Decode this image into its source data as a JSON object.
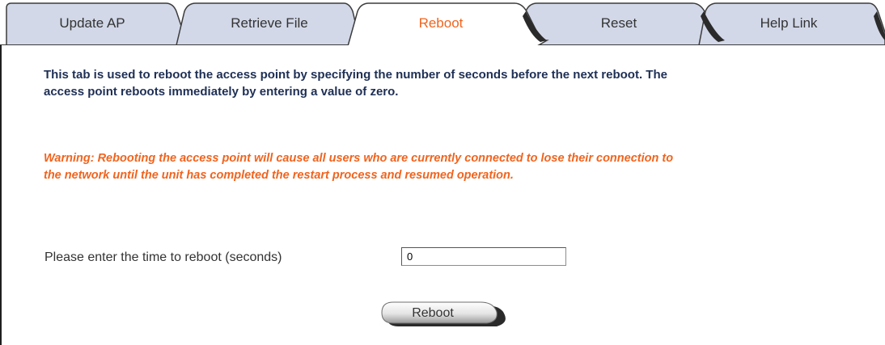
{
  "tabs": [
    {
      "label": "Update AP",
      "active": false
    },
    {
      "label": "Retrieve File",
      "active": false
    },
    {
      "label": "Reboot",
      "active": true
    },
    {
      "label": "Reset",
      "active": false
    },
    {
      "label": "Help Link",
      "active": false
    }
  ],
  "content": {
    "description": "This tab is used to reboot the access point by specifying the number of seconds before the next reboot. The access point reboots immediately by entering a value of zero.",
    "warning": "Warning: Rebooting the access point will cause all users who are currently connected to lose their connection to the network until the unit has completed the restart process and resumed operation.",
    "reboot_field_label": "Please enter the time to reboot (seconds)",
    "reboot_field_value": "0",
    "reboot_button_label": "Reboot"
  },
  "colors": {
    "tab_inactive_fill": "#d2d8e8",
    "tab_active_fill": "#ffffff",
    "tab_outline": "#3c3c3c",
    "accent_orange": "#f0641e",
    "heading_navy": "#1e2f55",
    "body_text": "#333333"
  },
  "icons": {
    "tab_shape": "curved-folder-tab"
  }
}
